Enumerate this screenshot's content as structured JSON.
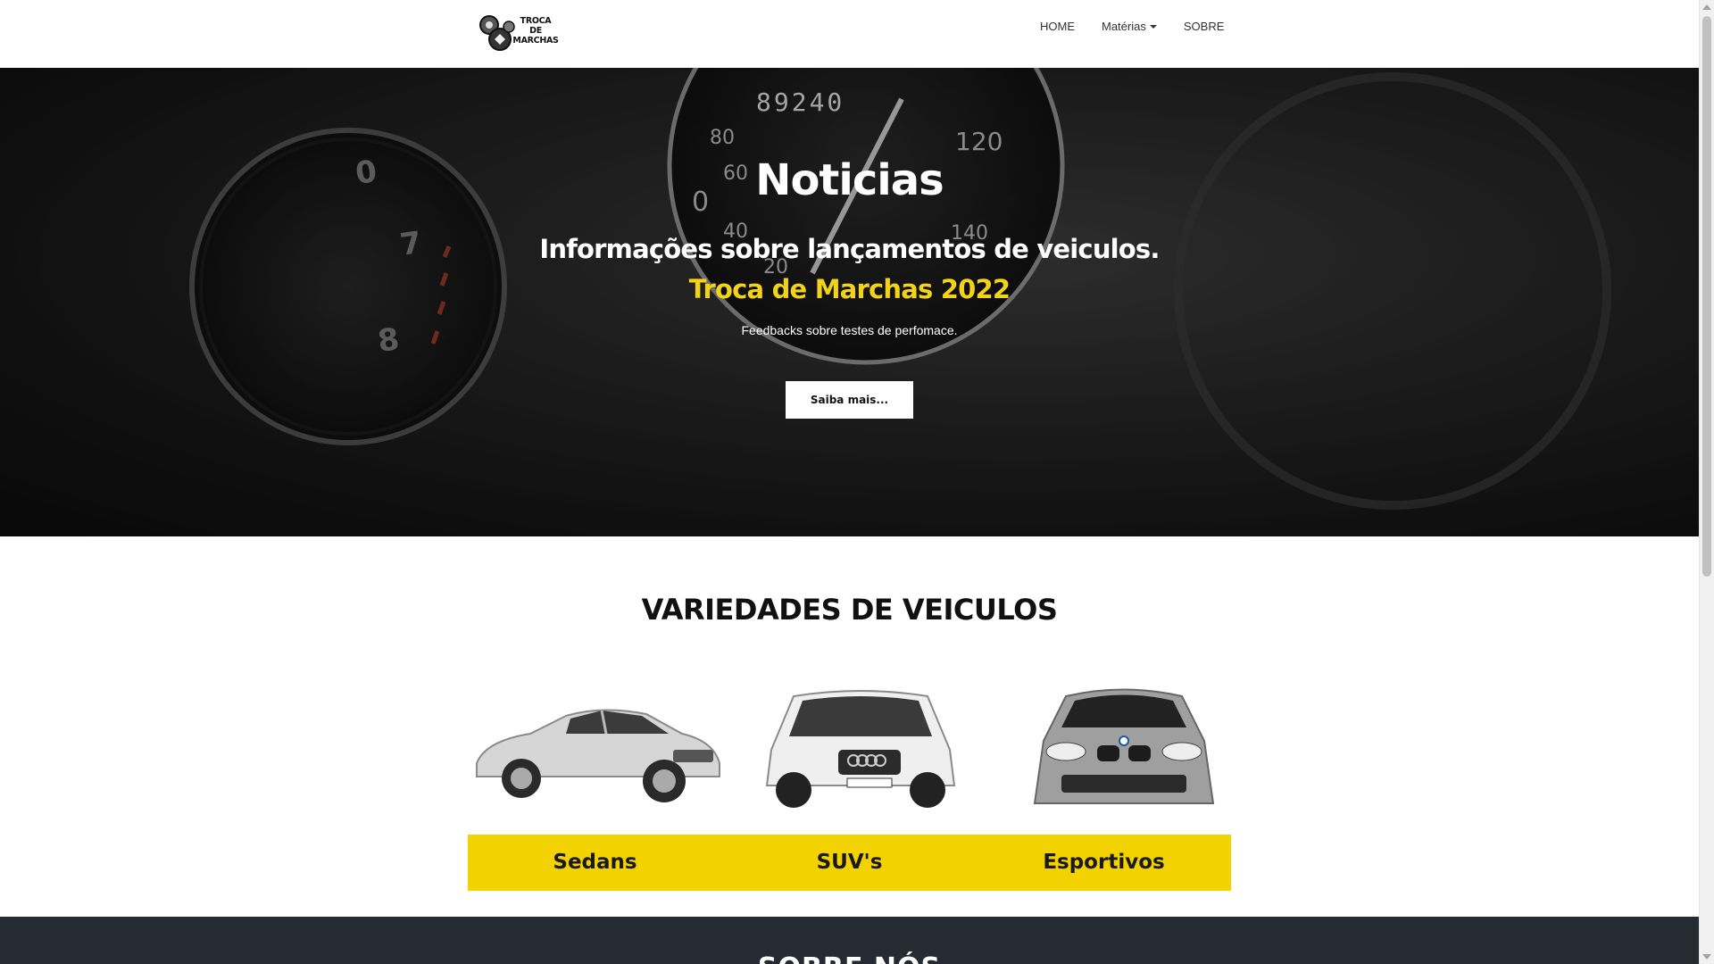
{
  "nav": {
    "logo_lines": [
      "TROCA",
      "DE",
      "MARCHAS"
    ],
    "items": [
      {
        "label": "HOME"
      },
      {
        "label": "Matérias"
      },
      {
        "label": "SOBRE"
      }
    ]
  },
  "hero": {
    "title": "Noticias",
    "subtitle": "Informações sobre lançamentos de veiculos.",
    "brand": "Troca de Marchas 2022",
    "text": "Feedbacks sobre testes de perfomace.",
    "button_label": "Saiba mais...",
    "odometer": "89240"
  },
  "variety": {
    "title": "VARIEDADES DE VEICULOS",
    "categories": [
      {
        "label": "Sedans"
      },
      {
        "label": "SUV's"
      },
      {
        "label": "Esportivos"
      }
    ]
  },
  "colors": {
    "accent_yellow": "#f2d200",
    "brand_text_yellow": "#f2d31a",
    "dark_section": "#262a33"
  },
  "about": {
    "title": "SOBRE NÓS"
  }
}
